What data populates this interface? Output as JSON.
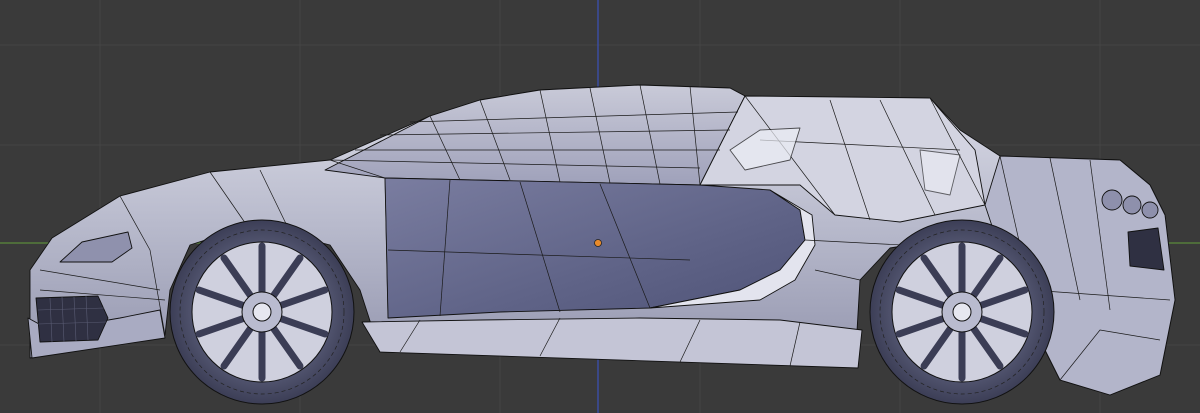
{
  "viewport": {
    "background_color": "#3a3a3a",
    "grid_color": "#444444",
    "axis_x_color": "#5a8a3a",
    "axis_z_color": "#3a4fb0",
    "object_origin_color": "#e88a2a",
    "wire_color": "#111111"
  },
  "scene": {
    "object": "car-body-mesh",
    "view": "side-orthographic",
    "shading": "solid-with-wireframe",
    "mesh_color_light": "#c7c8d8",
    "mesh_color_mid": "#9a9cb8",
    "mesh_color_dark": "#5d6083",
    "tire_color": "#50536e",
    "rim_color": "#d2d3e0"
  }
}
